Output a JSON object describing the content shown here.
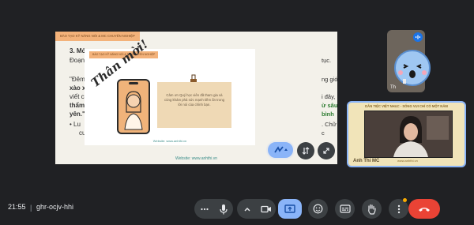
{
  "slide": {
    "tag": "BÀO TẠO KỸ NĂNG NÓI & MC CHUYÊN NGHIỆP",
    "lines": [
      {
        "text": "3. Mở",
        "bold": true
      },
      {
        "text": "Đoạn",
        "bold": false
      },
      {
        "text": "\"Đêm",
        "bold": false
      },
      {
        "text": "xào x",
        "bold": true
      },
      {
        "text": "viết c",
        "bold": false
      },
      {
        "text": "thẩm",
        "bold": true
      },
      {
        "text": "yên.\"",
        "bold": true
      },
      {
        "text": "•  Lu",
        "bold": false
      },
      {
        "text": "cu",
        "bold": false
      }
    ],
    "right_fragments": [
      {
        "text": "tục.",
        "color": "normal"
      },
      {
        "text": "ng gió",
        "color": "normal"
      },
      {
        "text": "i đây,",
        "color": "normal"
      },
      {
        "text": "ừ sâu",
        "color": "green"
      },
      {
        "text": "bình",
        "color": "green"
      },
      {
        "text": ". Chữ",
        "color": "normal"
      },
      {
        "text": "c",
        "color": "normal"
      }
    ],
    "footer": "Website: www.anhthi.vn"
  },
  "invite": {
    "tag": "BÀO TẠO KỸ NĂNG NÓI & MC CHUYÊN NGHIỆP",
    "script_title": "Thân mời!",
    "note": "Cảm ơn Quý học viên đã tham gia và cùng khám phá sức mạnh tiềm ẩn trong lời nói của chính bạn.",
    "footer": "Website: www.anhthi.vn"
  },
  "participants": {
    "small_name": "Th",
    "main_title": "DẪN TIỆC VIỆT NHẠC - SỐNG VUI CHÍ CÓ MỘT NĂM",
    "main_name": "Anh Thi MC",
    "main_sub": "www.anhthi.vn"
  },
  "bottom_bar": {
    "time": "21:55",
    "separator": "|",
    "meeting_code": "ghr-ocjv-hhi"
  },
  "colors": {
    "background": "#202124",
    "accent_blue": "#8ab4f8",
    "end_call": "#ea4335",
    "slide_tag": "#f3b27a",
    "green_text": "#2e7d32"
  },
  "icons": [
    "more-icon",
    "mic-icon",
    "chevron-up-icon",
    "camera-icon",
    "present-icon",
    "emoji-icon",
    "captions-icon",
    "raise-hand-icon",
    "more-vertical-icon",
    "end-call-icon",
    "reaction-icon",
    "rotate-icon",
    "expand-icon",
    "talking-icon"
  ]
}
